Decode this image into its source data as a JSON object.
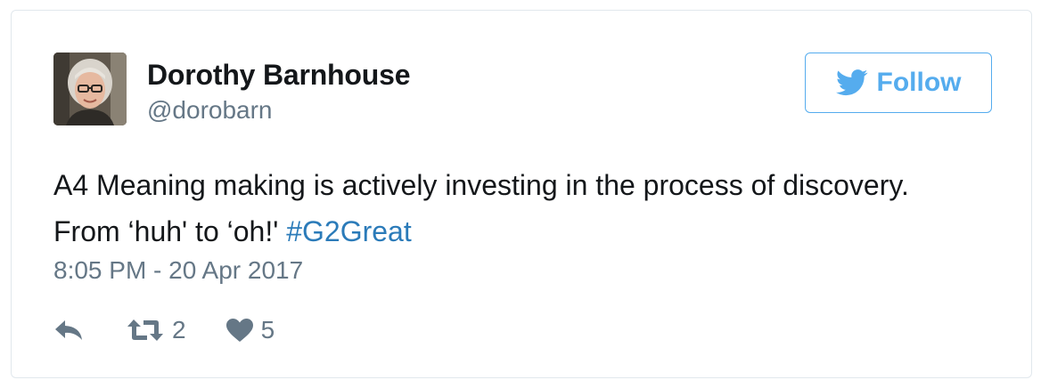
{
  "tweet": {
    "author_name": "Dorothy Barnhouse",
    "author_handle": "@dorobarn",
    "follow_label": "Follow",
    "text_main": "A4 Meaning making is actively investing in the process of discovery. From ‘huh' to ‘oh!' ",
    "hashtag": "#G2Great",
    "timestamp": "8:05 PM - 20 Apr 2017",
    "retweet_count": "2",
    "like_count": "5"
  },
  "icons": {
    "follow": "twitter-bird-icon",
    "reply": "reply-icon",
    "retweet": "retweet-icon",
    "like": "heart-icon"
  },
  "colors": {
    "accent": "#55acee",
    "hashtag": "#2b7bb9",
    "muted": "#657786",
    "text": "#14171a",
    "border": "#e1e8ed"
  }
}
